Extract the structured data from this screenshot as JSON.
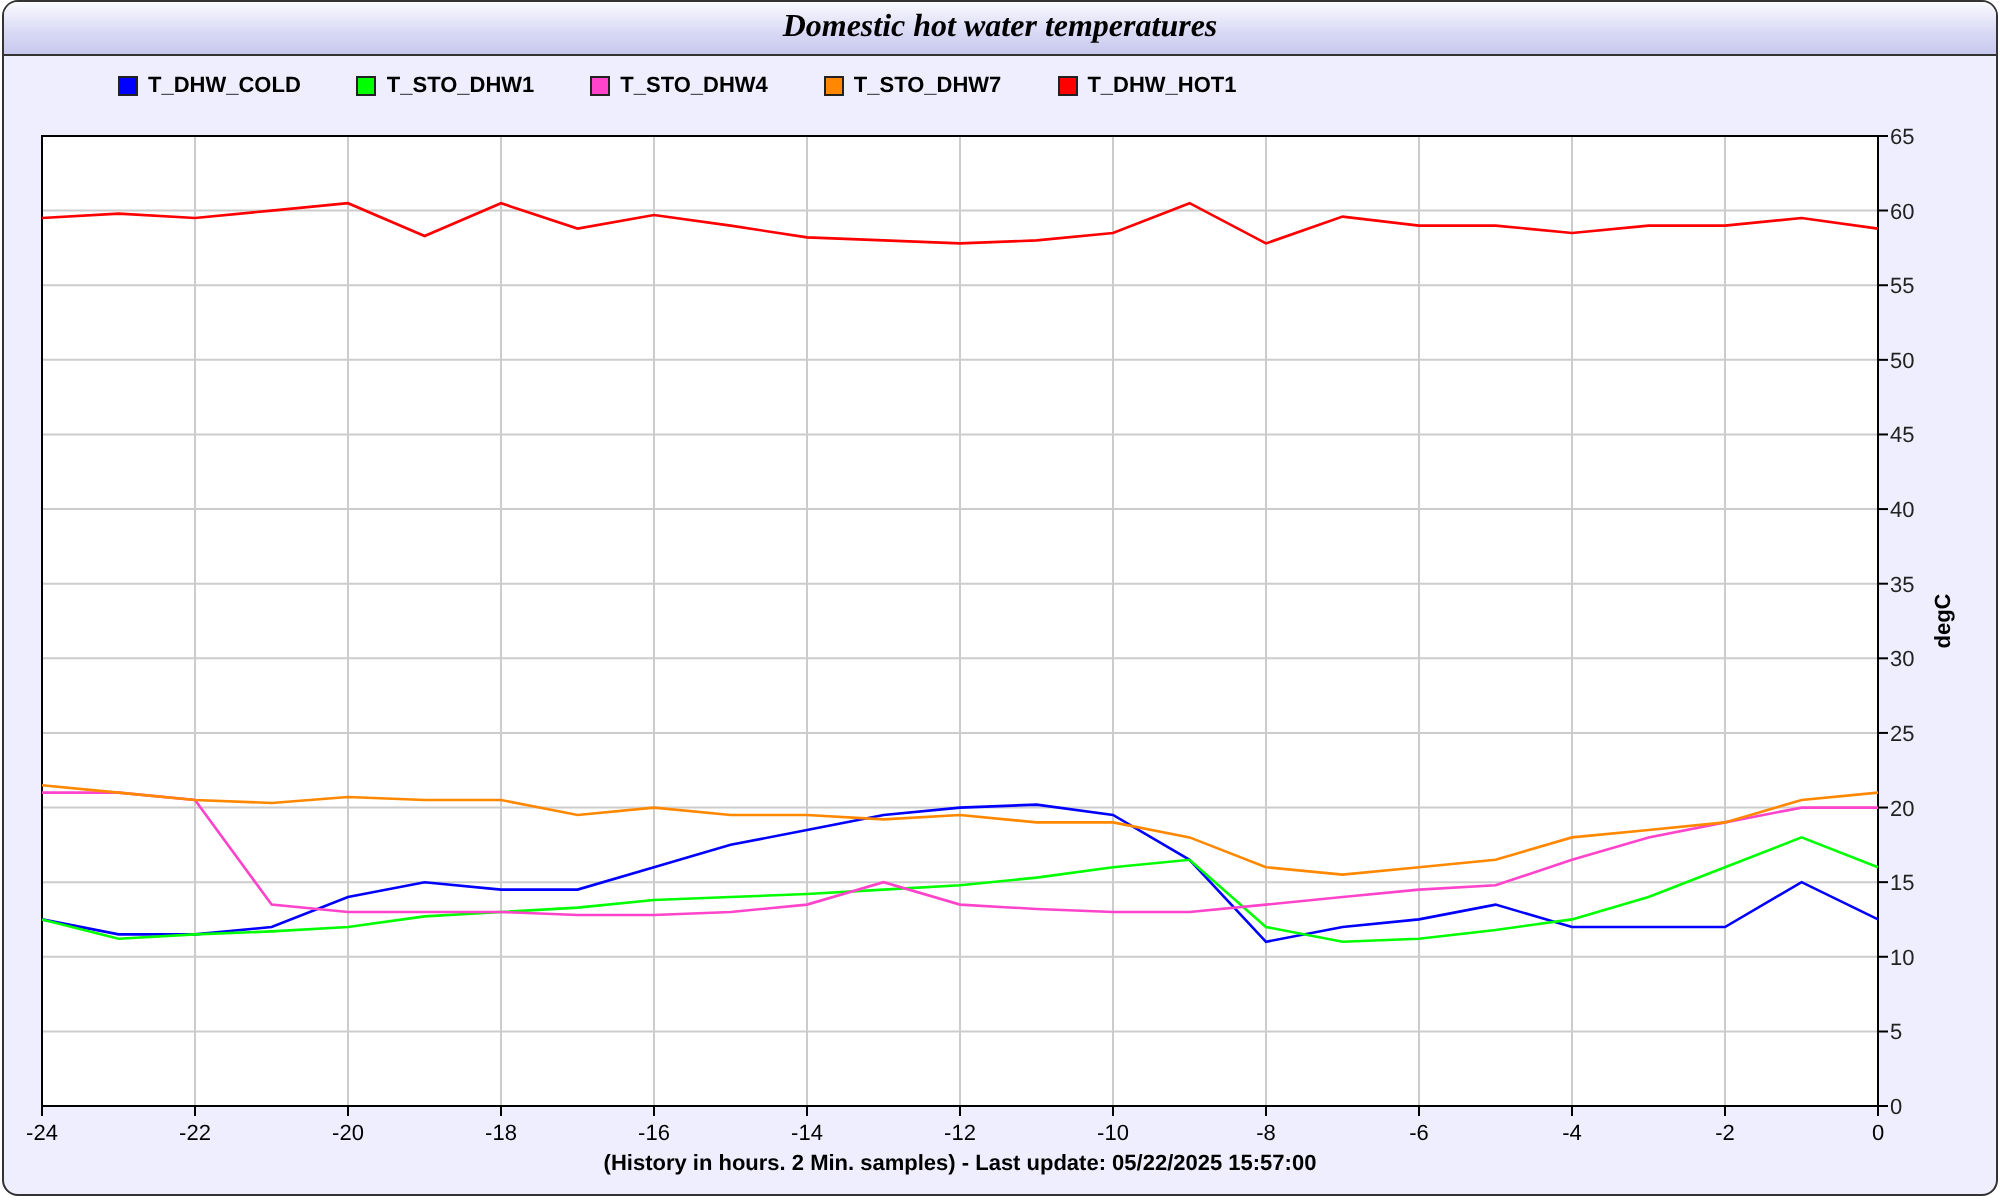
{
  "window": {
    "title": "Domestic hot water temperatures"
  },
  "chart": {
    "chart_data": {
      "type": "line",
      "xlabel": "(History in hours. 2 Min. samples) - Last update: 05/22/2025 15:57:00",
      "ylabel": "degC",
      "x": [
        -24,
        -23,
        -22,
        -21,
        -20,
        -19,
        -18,
        -17,
        -16,
        -15,
        -14,
        -13,
        -12,
        -11,
        -10,
        -9,
        -8,
        -7,
        -6,
        -5,
        -4,
        -3,
        -2,
        -1,
        0
      ],
      "series": [
        {
          "name": "T_DHW_COLD",
          "color": "#0000ff",
          "values": [
            12.5,
            11.5,
            11.5,
            12,
            14,
            15,
            14.5,
            14.5,
            16,
            17.5,
            18.5,
            19.5,
            20,
            20.2,
            19.5,
            16.5,
            11,
            12,
            12.5,
            13.5,
            12,
            12,
            12,
            15,
            12.5
          ]
        },
        {
          "name": "T_STO_DHW1",
          "color": "#00ff00",
          "values": [
            12.5,
            11.2,
            11.5,
            11.7,
            12,
            12.7,
            13,
            13.3,
            13.8,
            14,
            14.2,
            14.5,
            14.8,
            15.3,
            16,
            16.5,
            12,
            11,
            11.2,
            11.8,
            12.5,
            14,
            16,
            18,
            16
          ]
        },
        {
          "name": "T_STO_DHW4",
          "color": "#ff44cc",
          "values": [
            21,
            21,
            20.5,
            13.5,
            13,
            13,
            13,
            12.8,
            12.8,
            13,
            13.5,
            15,
            13.5,
            13.2,
            13,
            13,
            13.5,
            14,
            14.5,
            14.8,
            16.5,
            18,
            19,
            20,
            20
          ]
        },
        {
          "name": "T_STO_DHW7",
          "color": "#ff8800",
          "values": [
            21.5,
            21,
            20.5,
            20.3,
            20.7,
            20.5,
            20.5,
            19.5,
            20,
            19.5,
            19.5,
            19.2,
            19.5,
            19,
            19,
            18,
            16,
            15.5,
            16,
            16.5,
            18,
            18.5,
            19,
            20.5,
            21
          ]
        },
        {
          "name": "T_DHW_HOT1",
          "color": "#ff0000",
          "values": [
            59.5,
            59.8,
            59.5,
            60,
            60.5,
            58.3,
            60.5,
            58.8,
            59.7,
            59,
            58.2,
            58,
            57.8,
            58,
            58.5,
            60.5,
            57.8,
            59.6,
            59,
            59,
            58.5,
            59,
            59,
            59.5,
            58.8
          ]
        }
      ],
      "grid": true,
      "xlim": [
        -24,
        0
      ],
      "ylim": [
        0,
        65
      ],
      "xticks": [
        -24,
        -22,
        -20,
        -18,
        -16,
        -14,
        -12,
        -10,
        -8,
        -6,
        -4,
        -2,
        0
      ],
      "yticks": [
        0,
        5,
        10,
        15,
        20,
        25,
        30,
        35,
        40,
        45,
        50,
        55,
        60,
        65
      ]
    }
  }
}
